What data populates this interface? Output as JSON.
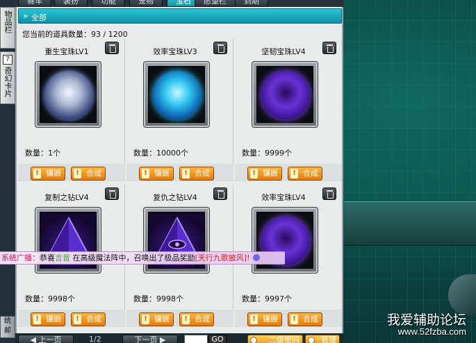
{
  "top_tabs": [
    {
      "label": "赛车",
      "active": false
    },
    {
      "label": "装扮",
      "active": false
    },
    {
      "label": "功能",
      "active": false
    },
    {
      "label": "宠物",
      "active": false
    },
    {
      "label": "宝石",
      "active": true
    },
    {
      "label": "愿望栏",
      "active": false
    },
    {
      "label": "到期",
      "active": false
    }
  ],
  "side_tabs": {
    "item_bar": "物品栏",
    "magic_cards": "奇幻卡片",
    "bottom_a": "统",
    "bottom_b": "邮"
  },
  "category": {
    "arrow": "»",
    "label": "全部"
  },
  "item_count": "您当前的道具数量：93 / 1200",
  "buttons": {
    "inlay": "镶嵌",
    "combine": "合成",
    "bang": "!"
  },
  "items": [
    {
      "name": "重生宝珠LV1",
      "qty": "数量：1个",
      "orb": "silver"
    },
    {
      "name": "效率宝珠LV3",
      "qty": "数量：10000个",
      "orb": "cyan"
    },
    {
      "name": "坚韧宝珠LV4",
      "qty": "数量：9999个",
      "orb": "violet"
    },
    {
      "name": "复制之钻LV4",
      "qty": "数量：9998个",
      "orb": "pyramid"
    },
    {
      "name": "复仇之钻LV4",
      "qty": "数量：9998个",
      "orb": "pyramid-eye"
    },
    {
      "name": "效率宝珠LV4",
      "qty": "数量：9997个",
      "orb": "violet"
    }
  ],
  "broadcast": {
    "prefix": "系统广播：",
    "congrats": "恭喜",
    "player": "言音",
    "middle": "在高级魔法阵中，召唤出了极品奖励",
    "reward": "[天行九歌披风]",
    "suffix": "!"
  },
  "bottom_nav": {
    "prev": "上一页",
    "page": "1/2",
    "next": "下一页",
    "go": "GO",
    "password": "二级密码",
    "manage": "管理"
  },
  "watermark": {
    "text": "我爱辅助论坛",
    "url": "www.52fzba.com"
  }
}
